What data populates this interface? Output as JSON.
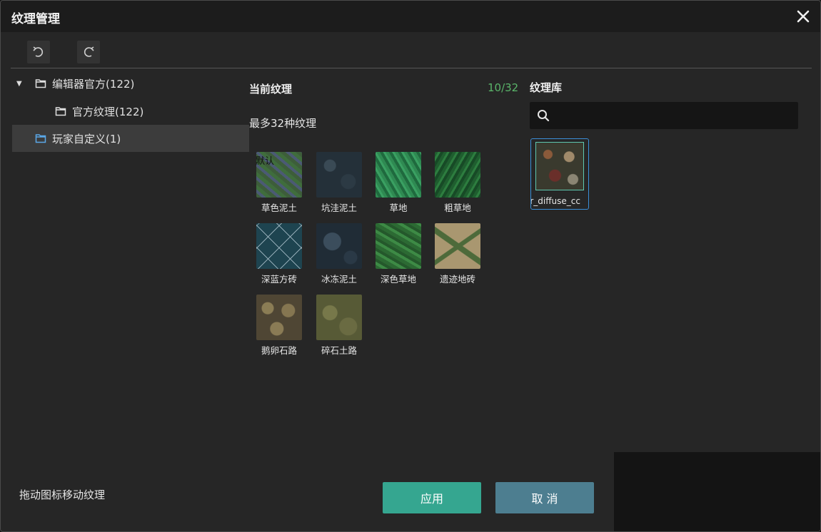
{
  "window": {
    "title": "纹理管理"
  },
  "tree": {
    "items": [
      {
        "label": "编辑器官方(122)",
        "level": 0,
        "expanded": true
      },
      {
        "label": "官方纹理(122)",
        "level": 1
      },
      {
        "label": "玩家自定义(1)",
        "level": 0,
        "selected": true
      }
    ]
  },
  "current": {
    "title": "当前纹理",
    "count": "10/32",
    "subtitle": "最多32种纹理",
    "default_tag": "默认",
    "textures": [
      {
        "label": "草色泥土",
        "icon": "grass-dirt-texture"
      },
      {
        "label": "坑洼泥土",
        "icon": "pitted-mud-texture"
      },
      {
        "label": "草地",
        "icon": "grass-texture"
      },
      {
        "label": "粗草地",
        "icon": "rough-grass-texture"
      },
      {
        "label": "深蓝方砖",
        "icon": "dark-blue-tile-texture"
      },
      {
        "label": "冰冻泥土",
        "icon": "frozen-mud-texture"
      },
      {
        "label": "深色草地",
        "icon": "dark-grass-texture"
      },
      {
        "label": "遗迹地砖",
        "icon": "ruins-tile-texture"
      },
      {
        "label": "鹅卵石路",
        "icon": "cobblestone-texture"
      },
      {
        "label": "碎石土路",
        "icon": "gravel-road-texture"
      }
    ]
  },
  "library": {
    "title": "纹理库",
    "search_placeholder": "",
    "items": [
      {
        "label": "ar_diffuse_cc"
      }
    ]
  },
  "footer": {
    "hint": "拖动图标移动纹理",
    "apply_label": "应用",
    "cancel_label": "取 消"
  },
  "colors": {
    "accent_green": "#5ab56a",
    "apply_button": "#35a690",
    "cancel_button": "#4d7e90",
    "selection_border": "#3b8fd9"
  }
}
